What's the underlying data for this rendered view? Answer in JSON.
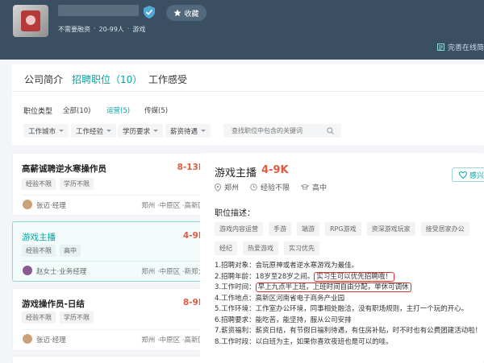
{
  "header": {
    "collect_label": "收藏",
    "meta": [
      "不需要融资",
      "·",
      "20-99人",
      "·",
      "游戏"
    ],
    "complete_label": "完善在线简"
  },
  "tabs": [
    {
      "label": "公司简介",
      "active": false
    },
    {
      "label": "招聘职位（10）",
      "active": true
    },
    {
      "label": "工作感受",
      "active": false
    }
  ],
  "filters": {
    "type_label": "职位类型",
    "options": [
      {
        "label": "全部(10)",
        "active": false
      },
      {
        "label": "运营(5)",
        "active": true
      },
      {
        "label": "传媒(5)",
        "active": false
      }
    ],
    "dropdowns": [
      "工作城市",
      "工作经验",
      "学历要求",
      "薪资待遇"
    ],
    "search_placeholder": "查找职位中包含的关键词"
  },
  "jobs": [
    {
      "title": "高薪诚聘逆水寒操作员",
      "salary": "8-13K",
      "tags": [
        "经验不限",
        "学历不限"
      ],
      "hr": "张迈·经理",
      "location": "郑州 ·中原区 ·高新区"
    },
    {
      "title": "游戏主播",
      "salary": "4-9K",
      "tags": [
        "经验不限",
        "高中"
      ],
      "hr": "赵女士·业务经理",
      "location": "郑州 ·中原区 ·新郑大"
    },
    {
      "title": "游戏操作员-日结",
      "salary": "8-9K",
      "tags": [
        "经验不限",
        "学历不限"
      ],
      "hr": "张迈·经理",
      "location": "郑州 ·中原区 ·高新区"
    }
  ],
  "detail": {
    "title": "游戏主播",
    "salary": "4-9K",
    "city": "郑州",
    "experience": "经验不限",
    "education": "高中",
    "fav_label": "感兴",
    "desc_heading": "职位描述：",
    "tags": [
      "游戏内容运营",
      "手游",
      "端游",
      "RPG游戏",
      "资深游戏玩家",
      "接受居家办公",
      "经纪",
      "热爱游戏",
      "实习优先"
    ],
    "l1": "1.招聘对象：会玩原神或者逆水寒游戏为最佳。",
    "l2a": "2.招聘年龄：18岁至28岁之间。",
    "l2b": "实习生可以优先招聘哦！",
    "l3a": "3.工作时间：",
    "l3b": "早上九点半上班，上班时间自由分配，单休可调休",
    "l4": "4.工作地点：高新区河南省电子商务产业园",
    "l5": "5.工作环境：工作室办公环境，同事相处融洽，没有职场规则，主打一个玩的开心。",
    "l6": "6.招聘要求：能吃苦，能坚持，服从公司安排",
    "l7": "7.薪资福利：薪资日结，有节假日福利待遇，有住房补贴，时不时也有公费团建活动啦！",
    "l8": "8.工作时段：以白班为主，如果你喜欢夜班也是可以的哇。"
  },
  "colors": {
    "accent": "#00a6a7",
    "salary": "#e05b3f",
    "header_bg": "#3a4f62",
    "highlight": "#d9342b"
  }
}
